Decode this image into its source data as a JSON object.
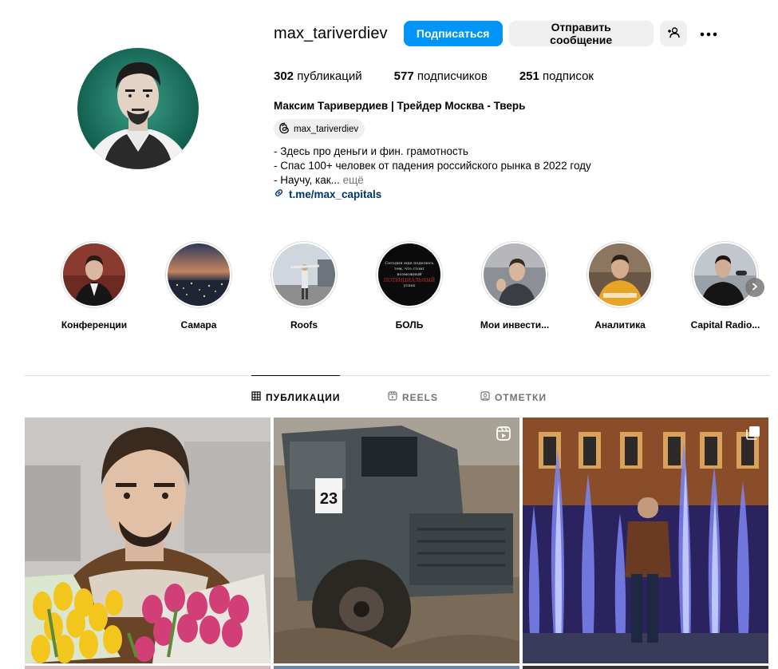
{
  "profile": {
    "username": "max_tariverdiev",
    "follow_label": "Подписаться",
    "message_label": "Отправить сообщение",
    "add_user_icon": "add-person-icon",
    "more_icon": "more-dots-icon",
    "stats": {
      "posts_count": "302",
      "posts_label": "публикаций",
      "followers_count": "577",
      "followers_label": "подписчиков",
      "following_count": "251",
      "following_label": "подписок"
    },
    "full_name": "Максим Таривердиев | Трейдер Москва - Тверь",
    "threads_handle": "max_tariverdiev",
    "bio_lines": [
      "- Здесь про деньги и фин. грамотность",
      "- Спас 100+ человек от падения российского рынка в 2022 году",
      "- Научу, как..."
    ],
    "bio_more": "ещё",
    "link": "t.me/max_capitals"
  },
  "highlights": [
    {
      "label": "Конференции"
    },
    {
      "label": "Самара"
    },
    {
      "label": "Roofs"
    },
    {
      "label": "БОЛЬ"
    },
    {
      "label": "Мои инвести..."
    },
    {
      "label": "Аналитика"
    },
    {
      "label": "Capital Radio..."
    }
  ],
  "boly_cover_text": {
    "line1": "Сегодня еще поделюсь",
    "line2": "тем, что стоит",
    "line3": "возможный",
    "line4": "ПОТЕНЦИАЛЬНЫЙ",
    "line5": "успех"
  },
  "tabs": [
    {
      "label": "ПУБЛИКАЦИИ",
      "active": true,
      "icon": "grid-icon"
    },
    {
      "label": "REELS",
      "active": false,
      "icon": "reels-icon"
    },
    {
      "label": "ОТМЕТКИ",
      "active": false,
      "icon": "tagged-icon"
    }
  ],
  "posts": [
    {
      "type": "photo"
    },
    {
      "type": "reel",
      "badge_icon": "reel-icon"
    },
    {
      "type": "carousel",
      "badge_icon": "carousel-icon"
    }
  ],
  "truck_number": "23",
  "colors": {
    "accent": "#0095f6",
    "link": "#00376b",
    "secondary_text": "#737373",
    "button_gray": "#efefef",
    "border": "#dbdbdb"
  }
}
